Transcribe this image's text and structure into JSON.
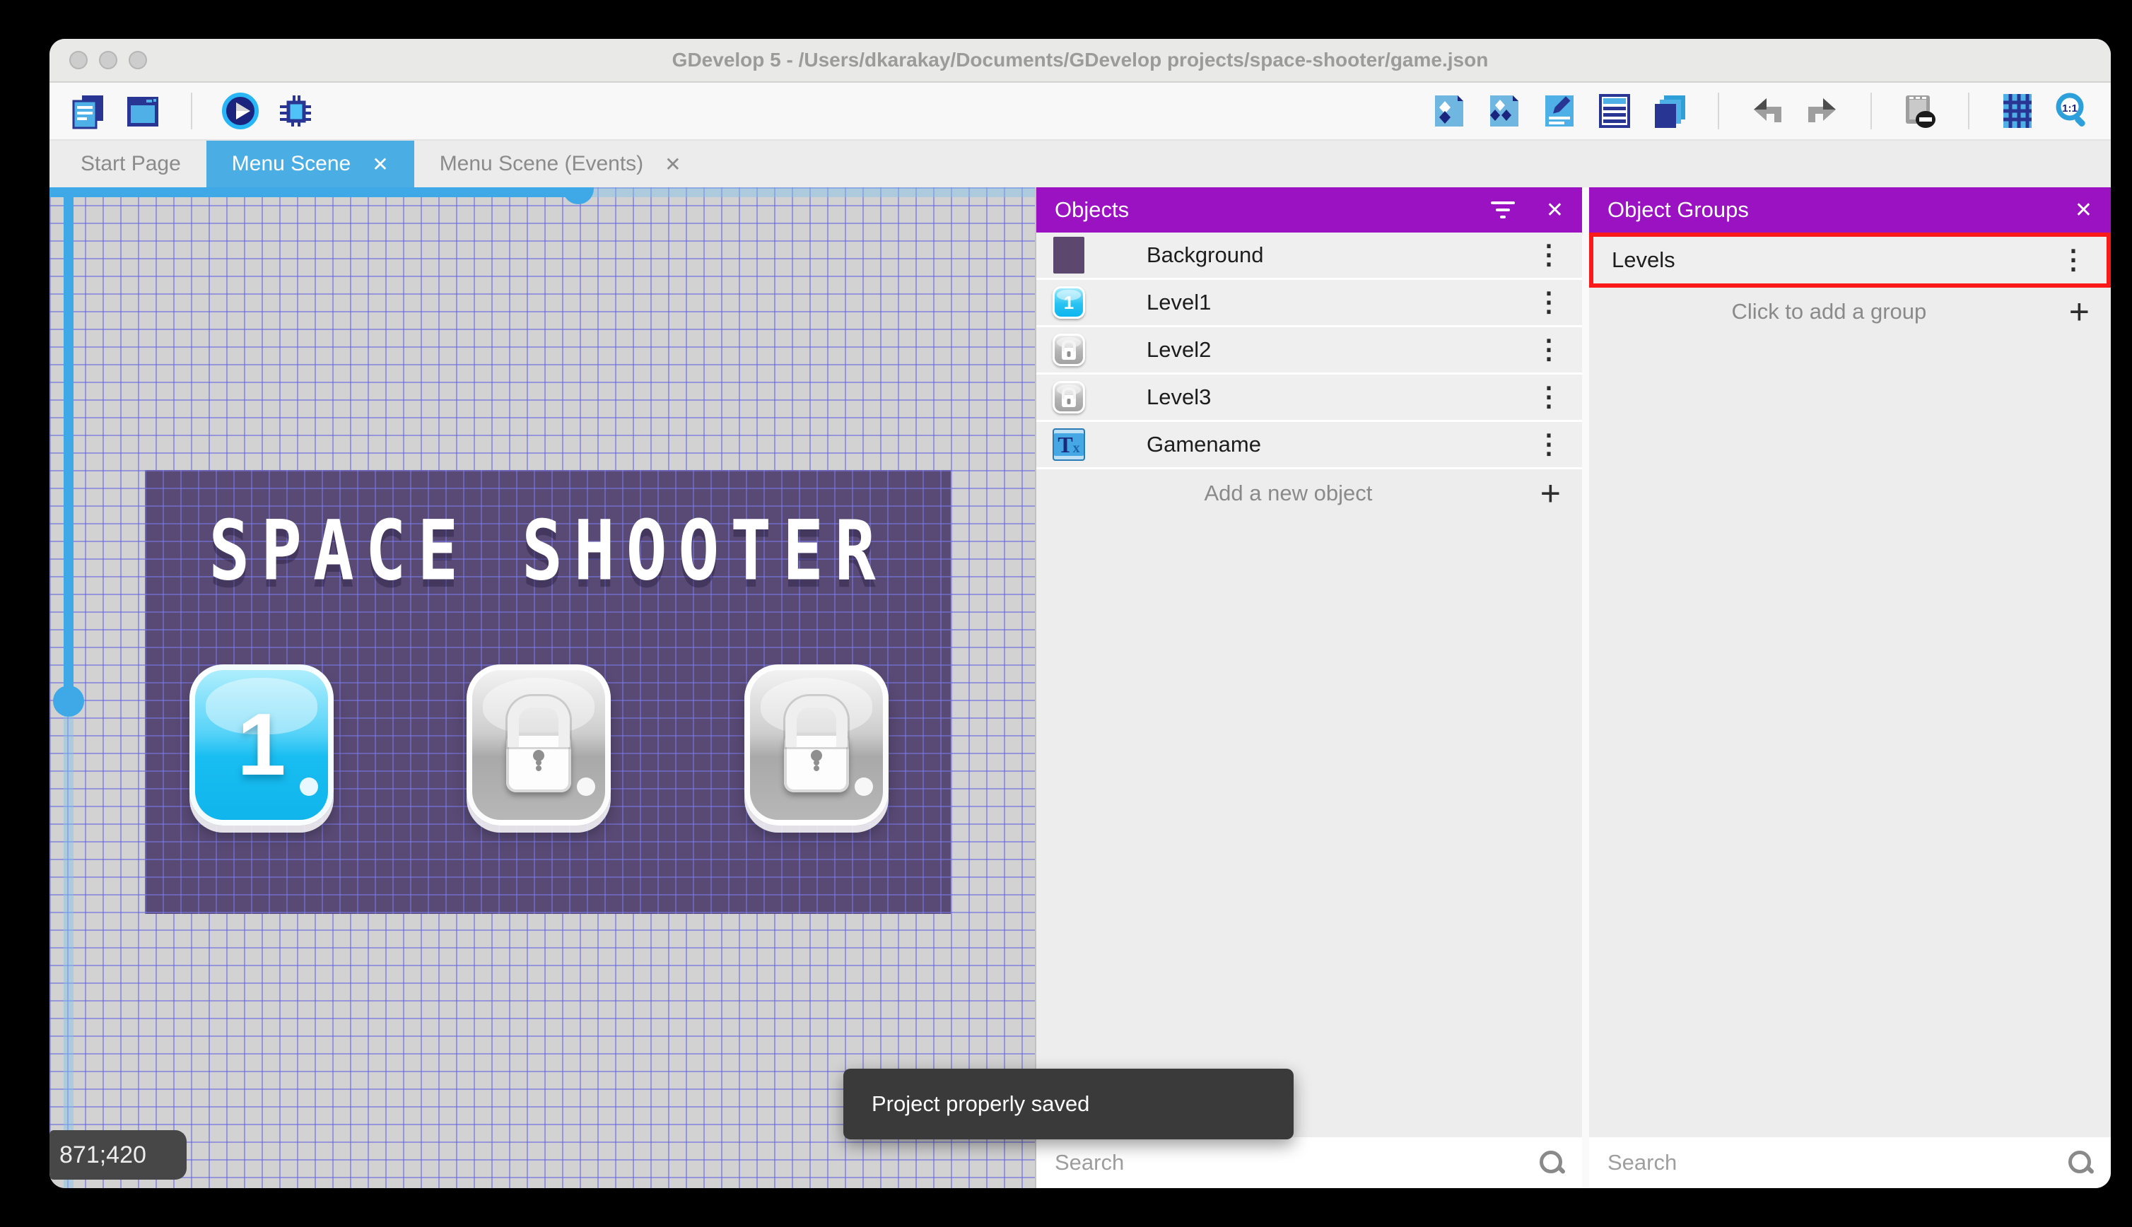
{
  "window": {
    "title": "GDevelop 5 - /Users/dkarakay/Documents/GDevelop projects/space-shooter/game.json"
  },
  "toolbar": {
    "left_icons": [
      "project-manager",
      "scene-editor",
      "play",
      "debug"
    ],
    "right_icons": [
      "objects-editor",
      "object-groups-editor",
      "properties",
      "instances-list",
      "layers",
      "undo",
      "redo",
      "window-mask",
      "grid",
      "zoom-1-1"
    ]
  },
  "tabs": [
    {
      "label": "Start Page",
      "active": false,
      "closable": false
    },
    {
      "label": "Menu Scene",
      "active": true,
      "closable": true
    },
    {
      "label": "Menu Scene (Events)",
      "active": false,
      "closable": true
    }
  ],
  "canvas": {
    "coords_badge": "871;420",
    "scene": {
      "title_text": "SPACE SHOOTER",
      "level_buttons": [
        {
          "type": "unlocked",
          "label": "1"
        },
        {
          "type": "locked"
        },
        {
          "type": "locked"
        }
      ]
    }
  },
  "objects_panel": {
    "title": "Objects",
    "items": [
      {
        "name": "Background",
        "icon": "background-swatch"
      },
      {
        "name": "Level1",
        "icon": "level1-button",
        "icon_glyph": "1"
      },
      {
        "name": "Level2",
        "icon": "locked-button"
      },
      {
        "name": "Level3",
        "icon": "locked-button"
      },
      {
        "name": "Gamename",
        "icon": "text-object",
        "icon_main": "T",
        "icon_sub": "x"
      }
    ],
    "add_label": "Add a new object",
    "search_placeholder": "Search"
  },
  "object_groups_panel": {
    "title": "Object Groups",
    "items": [
      {
        "name": "Levels",
        "highlighted": true
      }
    ],
    "add_label": "Click to add a group",
    "search_placeholder": "Search"
  },
  "toast": {
    "message": "Project properly saved"
  },
  "glyphs": {
    "plus": "+",
    "close": "✕",
    "kebab": "⋮"
  },
  "colors": {
    "accent_blue": "#4aaee4",
    "panel_purple": "#9a12c2",
    "annotation_red": "#fb1a1a",
    "toast_bg": "#3a3a3a",
    "scene_purple": "#594a75",
    "button_cyan": "#18bdf1",
    "scroll_blue": "#3fa9e8"
  }
}
